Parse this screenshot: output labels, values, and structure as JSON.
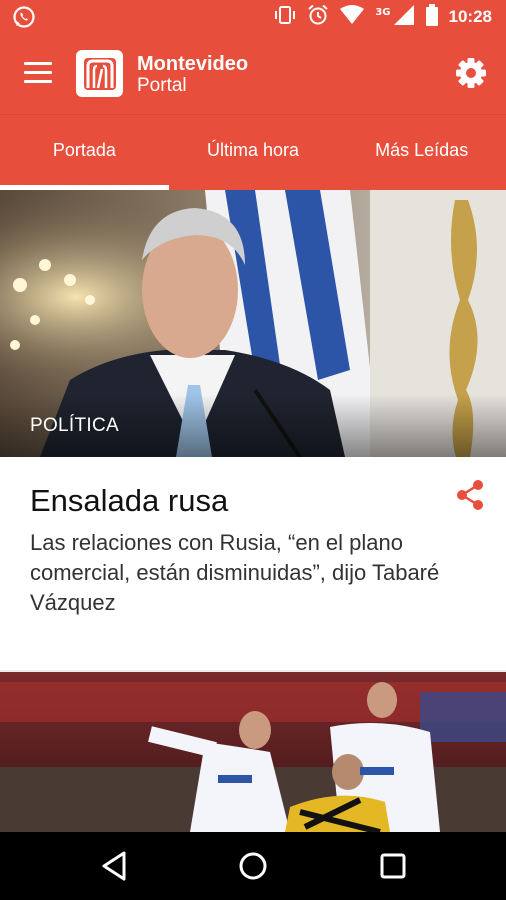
{
  "statusbar": {
    "network_label": "3G",
    "time": "10:28"
  },
  "appbar": {
    "brand_line1": "Montevideo",
    "brand_line2": "Portal"
  },
  "tabs": [
    {
      "label": "Portada",
      "active": true
    },
    {
      "label": "Última hora",
      "active": false
    },
    {
      "label": "Más Leídas",
      "active": false
    }
  ],
  "articles": [
    {
      "category": "POLÍTICA",
      "title": "Ensalada rusa",
      "summary": "Las relaciones con Rusia, “en el plano comercial, están disminuidas”, dijo Tabaré Vázquez"
    }
  ],
  "colors": {
    "brand": "#e84e3c",
    "share_icon": "#e84e3c"
  },
  "icons": [
    "whatsapp-icon",
    "vibrate-icon",
    "alarm-icon",
    "wifi-icon",
    "signal-icon",
    "battery-icon",
    "menu-icon",
    "logo-icon",
    "gear-icon",
    "share-icon",
    "back-icon",
    "home-icon",
    "recents-icon"
  ]
}
